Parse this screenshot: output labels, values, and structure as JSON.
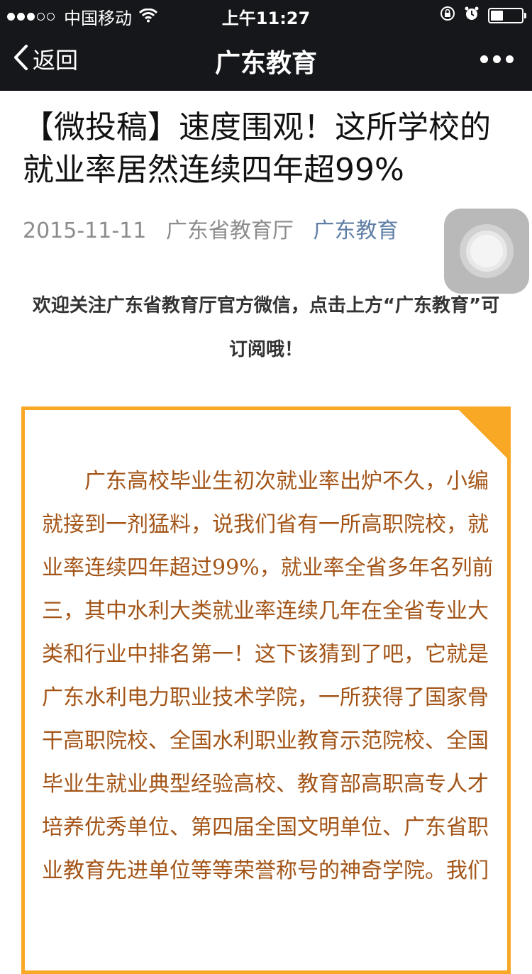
{
  "status_bar": {
    "carrier": "中国移动",
    "time": "上午11:27",
    "signal_filled": 3,
    "signal_total": 5
  },
  "nav": {
    "back_label": "返回",
    "title": "广东教育"
  },
  "article": {
    "title": "【微投稿】速度围观！这所学校的就业率居然连续四年超99%",
    "date": "2015-11-11",
    "author": "广东省教育厅",
    "account": "广东教育",
    "welcome": "欢迎关注广东省教育厅官方微信，点击上方“广东教育”可订阅哦！",
    "body": "广东高校毕业生初次就业率出炉不久，小编就接到一剂猛料，说我们省有一所高职院校，就业率连续四年超过99%，就业率全省多年名列前三，其中水利大类就业率连续几年在全省专业大类和行业中排名第一！这下该猜到了吧，它就是广东水利电力职业技术学院，一所获得了国家骨干高职院校、全国水利职业教育示范院校、全国毕业生就业典型经验高校、教育部高职高专人才培养优秀单位、第四届全国文明单位、广东省职业教育先进单位等等荣誉称号的神奇学院。我们"
  },
  "colors": {
    "bar_bg": "#16171b",
    "accent_border": "#f9a826",
    "body_text": "#a35417",
    "account_link": "#607fa6"
  }
}
